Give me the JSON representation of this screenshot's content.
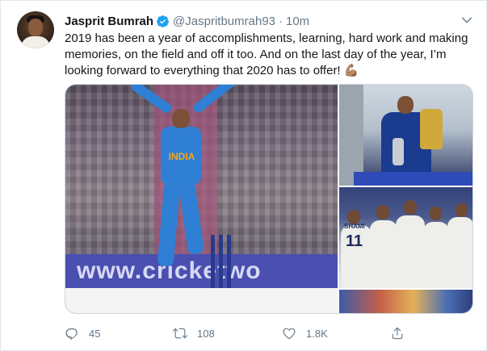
{
  "tweet": {
    "author_name": "Jasprit Bumrah",
    "handle": "@Jaspritbumrah93",
    "separator": "·",
    "time": "10m",
    "text": "2019 has been a year of accomplishments, learning, hard work and making memories, on the field and off it too. And on the last day of the year, I’m looking forward to everything that 2020 has to offer! 💪🏽"
  },
  "media": {
    "main_banner_text": "www.cricketwo",
    "main_jersey_text": "INDIA",
    "mid_jersey_name": "SHAMI",
    "mid_jersey_number": "11"
  },
  "actions": {
    "replies": "45",
    "retweets": "108",
    "likes": "1.8K"
  },
  "colors": {
    "verified": "#1da1f2",
    "icon_gray": "#657786"
  },
  "icons": {
    "verified": "verified-badge-icon",
    "menu": "chevron-down-icon",
    "reply": "reply-icon",
    "retweet": "retweet-icon",
    "like": "heart-icon",
    "share": "share-icon"
  }
}
